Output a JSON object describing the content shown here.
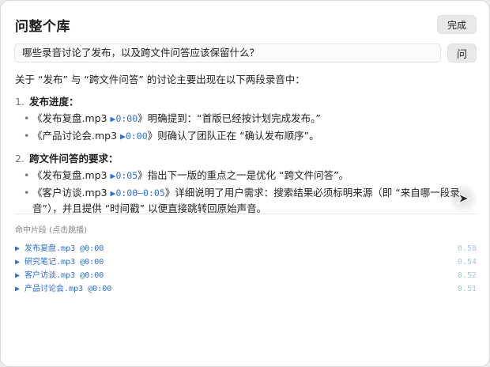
{
  "window": {
    "title": "问整个库",
    "done_label": "完成"
  },
  "query": {
    "value": "哪些录音讨论了发布，以及跨文件问答应该保留什么？",
    "ask_label": "问"
  },
  "answer": {
    "intro": "关于 “发布” 与 “跨文件问答” 的讨论主要出现在以下两段录音中：",
    "sections": [
      {
        "num": "1.",
        "title": "发布进度：",
        "items": [
          {
            "pre": "《发布复盘.mp3 ",
            "ts": "▶0:00",
            "post": "》明确提到：“首版已经按计划完成发布。”"
          },
          {
            "pre": "《产品讨论会.mp3 ",
            "ts": "▶0:00",
            "post": "》则确认了团队正在 “确认发布顺序”。"
          }
        ]
      },
      {
        "num": "2.",
        "title": "跨文件问答的要求：",
        "items": [
          {
            "pre": "《发布复盘.mp3 ",
            "ts": "▶0:05",
            "post": "》指出下一版的重点之一是优化 “跨文件问答”。"
          },
          {
            "pre": "《客户访谈.mp3 ",
            "ts": "▶0:00–0:05",
            "post": "》详细说明了用户需求：搜索结果必须标明来源（即 “来自哪一段录音”），并且提供 “时间戳” 以便直接跳转回原始声音。"
          }
        ]
      }
    ]
  },
  "hits": {
    "label": "命中片段 (点击跳播)",
    "items": [
      {
        "text": "▶ 发布复盘.mp3  @0:00",
        "score": "0.58"
      },
      {
        "text": "▶ 研究笔记.mp3  @0:00",
        "score": "0.54"
      },
      {
        "text": "▶ 客户访谈.mp3  @0:00",
        "score": "0.52"
      },
      {
        "text": "▶ 产品讨论会.mp3  @0:00",
        "score": "0.51"
      }
    ]
  },
  "colors": {
    "accent": "#2f6fd6",
    "score": "#a8c4ea"
  },
  "icons": {
    "cursor": "pointer-arrow-icon"
  }
}
